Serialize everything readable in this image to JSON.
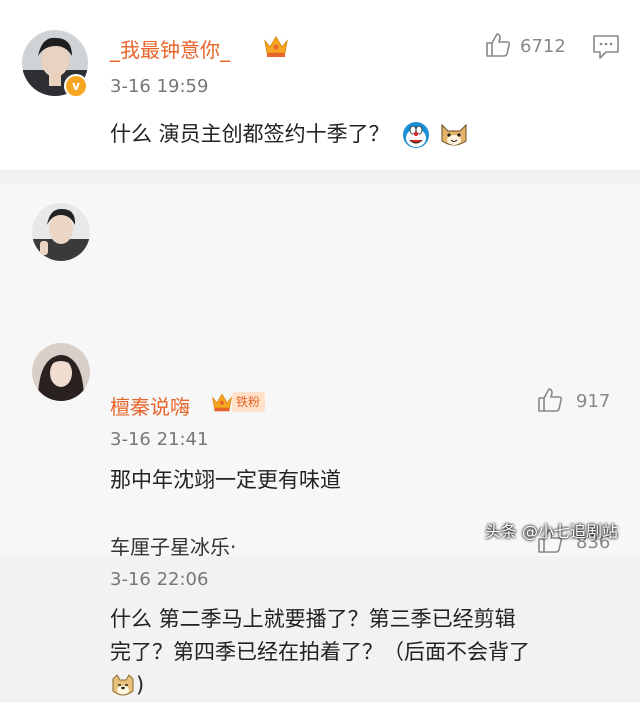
{
  "main_comment": {
    "username": "_我最钟意你_",
    "time": "3-16 19:59",
    "content": "什么 演员主创都签约十季了？",
    "likes": "6712",
    "verified_badge": "v",
    "emojis": [
      "doraemon-emoji",
      "cat-emoji"
    ]
  },
  "replies": [
    {
      "username": "檀秦说嗨",
      "badge": "铁粉",
      "time": "3-16 21:41",
      "content": "那中年沈翊一定更有味道",
      "likes": "917"
    },
    {
      "username": "车厘子星冰乐·",
      "time": "3-16 22:06",
      "content_line1": "什么 第二季马上就要播了？第三季已经剪辑",
      "content_line2": "完了？第四季已经在拍着了？（后面不会背了",
      "content_line3": ")",
      "likes": "836",
      "emojis": [
        "doge-emoji"
      ]
    }
  ],
  "watermark": "头条 @小七追剧站",
  "colors": {
    "username_orange": "#e8652b",
    "badge_bg": "#ffe2c9",
    "vip_gold": "#f5a623"
  }
}
